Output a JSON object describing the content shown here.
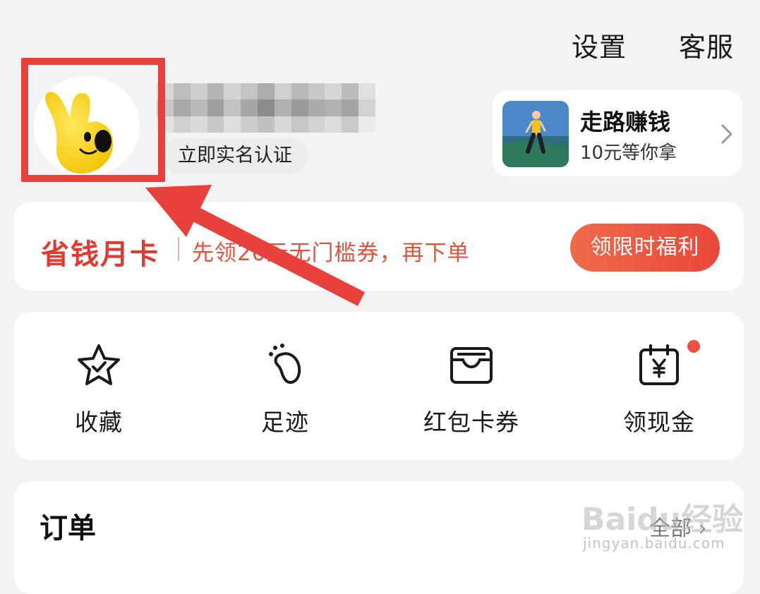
{
  "header": {
    "settings_label": "设置",
    "service_label": "客服"
  },
  "profile": {
    "verify_label": "立即实名认证"
  },
  "walk_card": {
    "title": "走路赚钱",
    "subtitle": "10元等你拿"
  },
  "promo": {
    "title": "省钱月卡",
    "description": "先领20元无门槛券，再下单",
    "button_label": "领限时福利"
  },
  "shortcuts": [
    {
      "label": "收藏",
      "icon": "star-check-icon"
    },
    {
      "label": "足迹",
      "icon": "footprint-icon"
    },
    {
      "label": "红包卡券",
      "icon": "wallet-icon"
    },
    {
      "label": "领现金",
      "icon": "calendar-yuan-icon"
    }
  ],
  "orders": {
    "title": "订单",
    "all_label": "全部 ›"
  },
  "watermark": {
    "logo": "Baidu经验",
    "url": "jingyan.baidu.com"
  },
  "colors": {
    "accent_red": "#e23a2e",
    "button_red": "#e8473a",
    "annotation_red": "#e8403a",
    "background": "#f3f3f5"
  }
}
